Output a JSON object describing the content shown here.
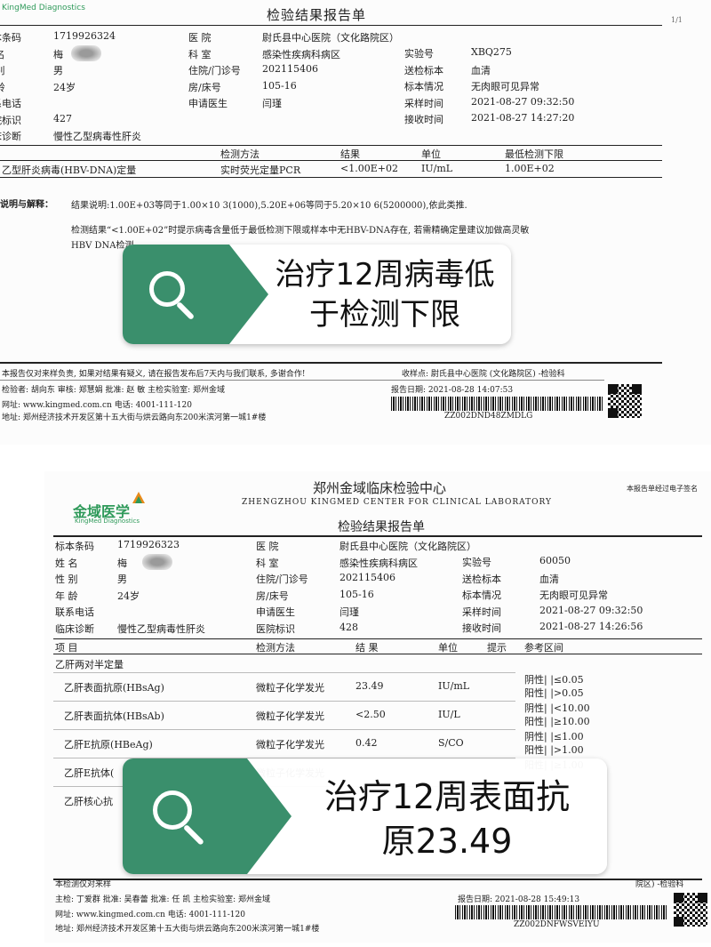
{
  "report1": {
    "logo": "KingMed Diagnostics",
    "title": "检验结果报告单",
    "page": "1/1",
    "info": [
      {
        "label": "标本条码",
        "value": "1719926324"
      },
      {
        "label": "姓  名",
        "value": "梅"
      },
      {
        "label": "性  别",
        "value": "男"
      },
      {
        "label": "年  龄",
        "value": "24岁"
      },
      {
        "label": "联系电话",
        "value": ""
      },
      {
        "label": "医院标识",
        "value": "427"
      },
      {
        "label": "临床诊断",
        "value": "慢性乙型病毒性肝炎"
      }
    ],
    "info_mid": [
      {
        "label": "医  院",
        "value": "尉氏县中心医院（文化路院区）"
      },
      {
        "label": "科  室",
        "value": "感染性疾病科病区"
      },
      {
        "label": "住院/门诊号",
        "value": "202115406"
      },
      {
        "label": "房/床号",
        "value": "105-16"
      },
      {
        "label": "申请医生",
        "value": "闫瑾"
      }
    ],
    "info_right": [
      {
        "label": "实验号",
        "value": "XBQ275"
      },
      {
        "label": "送检标本",
        "value": "血清"
      },
      {
        "label": "标本情况",
        "value": "无肉眼可见异常"
      },
      {
        "label": "采样时间",
        "value": "2021-08-27 09:32:50"
      },
      {
        "label": "接收时间",
        "value": "2021-08-27 14:27:20"
      }
    ],
    "table_headers": [
      "检测方法",
      "结果",
      "单位",
      "最低检测下限"
    ],
    "row": {
      "item": "乙型肝炎病毒(HBV-DNA)定量",
      "method": "实时荧光定量PCR",
      "result": "<1.00E+02",
      "unit": "IU/mL",
      "limit": "1.00E+02"
    },
    "note_label": "说明与解释：",
    "note1": "结果说明:1.00E+03等同于1.00×10 3(1000),5.20E+06等同于5.20×10 6(5200000),依此类推.",
    "note2": "检测结果“<1.00E+02”时提示病毒含量低于最低检测下限或样本中无HBV-DNA存在, 若需精确定量建议加做高灵敏",
    "note3": "HBV DNA检测",
    "footer1": "本报告仅对来样负责, 如果对结果有疑义, 请在报告发布后7天内与我们联系, 多谢合作!",
    "footer_recv": "收样点: 尉氏县中心医院 (文化路院区) -检验科",
    "footer2": "检验者: 胡向东  审核: 郑慧娟  批准: 赵 敏  主检实验室: 郑州金域",
    "report_date": "报告日期: 2021-08-28 14:07:53",
    "footer3": "网址: www.kingmed.com.cn   电话: 4001-111-120",
    "footer4": "地址: 郑州经济技术开发区第十五大街与烘云路向东200米滨河第一城1#楼",
    "barcode_text": "ZZ002DND48ZMDLG"
  },
  "overlay1": {
    "line1": "治疗12周病毒低",
    "line2": "于检测下限"
  },
  "report2": {
    "org_cn": "郑州金域临床检验中心",
    "org_en": "ZHENGZHOU KINGMED CENTER FOR CLINICAL LABORATORY",
    "logo": "金域医学",
    "logo_en": "KingMed Diagnostics",
    "sig_note": "本报告单经过电子签名",
    "title": "检验结果报告单",
    "info": [
      {
        "label": "标本条码",
        "value": "1719926323"
      },
      {
        "label": "姓  名",
        "value": "梅"
      },
      {
        "label": "性  别",
        "value": "男"
      },
      {
        "label": "年  龄",
        "value": "24岁"
      },
      {
        "label": "联系电话",
        "value": ""
      },
      {
        "label": "临床诊断",
        "value": "慢性乙型病毒性肝炎"
      }
    ],
    "info_mid": [
      {
        "label": "医  院",
        "value": "尉氏县中心医院（文化路院区）"
      },
      {
        "label": "科  室",
        "value": "感染性疾病科病区"
      },
      {
        "label": "住院/门诊号",
        "value": "202115406"
      },
      {
        "label": "房/床号",
        "value": "105-16"
      },
      {
        "label": "申请医生",
        "value": "闫瑾"
      },
      {
        "label": "医院标识",
        "value": "428"
      }
    ],
    "info_right": [
      {
        "label": "实验号",
        "value": "60050"
      },
      {
        "label": "送检标本",
        "value": "血清"
      },
      {
        "label": "标本情况",
        "value": "无肉眼可见异常"
      },
      {
        "label": "采样时间",
        "value": "2021-08-27 09:32:50"
      },
      {
        "label": "接收时间",
        "value": "2021-08-27 14:26:56"
      }
    ],
    "table_headers": [
      "项  目",
      "检测方法",
      "结  果",
      "单位",
      "提示",
      "参考区间"
    ],
    "group": "乙肝两对半定量",
    "rows": [
      {
        "item": "乙肝表面抗原(HBsAg)",
        "method": "微粒子化学发光",
        "result": "23.49",
        "unit": "IU/mL",
        "ref1": "阴性| |≤0.05",
        "ref2": "阳性| |>0.05"
      },
      {
        "item": "乙肝表面抗体(HBsAb)",
        "method": "微粒子化学发光",
        "result": "<2.50",
        "unit": "IU/L",
        "ref1": "阴性| |<10.00",
        "ref2": "阳性| |≥10.00"
      },
      {
        "item": "乙肝E抗原(HBeAg)",
        "method": "微粒子化学发光",
        "result": "0.42",
        "unit": "S/CO",
        "ref1": "阴性| |≤1.00",
        "ref2": "阳性| |>1.00"
      },
      {
        "item": "乙肝E抗体(",
        "method": "微粒子化学发光",
        "result": "",
        "unit": "",
        "ref1": "阳性| |≥1.00",
        "ref2": ""
      },
      {
        "item": "乙肝核心抗",
        "method": "",
        "result": "",
        "unit": "",
        "ref1": "",
        "ref2": ""
      }
    ],
    "footer1": "本检测仅对来样",
    "footer_recv": "院区) -检验科",
    "footer2": "主检: 丁爱群  批准: 吴春蕾  批准: 任 凯  主检实验室: 郑州金域",
    "report_date": "报告日期: 2021-08-28 15:49:13",
    "footer3": "网址: www.kingmed.com.cn   电话: 4001-111-120",
    "footer4": "地址: 郑州经济技术开发区第十五大街与烘云路向东200米滨河第一城1#楼",
    "barcode_text": "ZZ002DNFWSVEIYU"
  },
  "overlay2": {
    "line1": "治疗12周表面抗",
    "line2": "原23.49"
  },
  "colors": {
    "accent_green": "#3a8f6c",
    "logo_green": "#2f9a5a",
    "logo_orange": "#e88a1a"
  }
}
